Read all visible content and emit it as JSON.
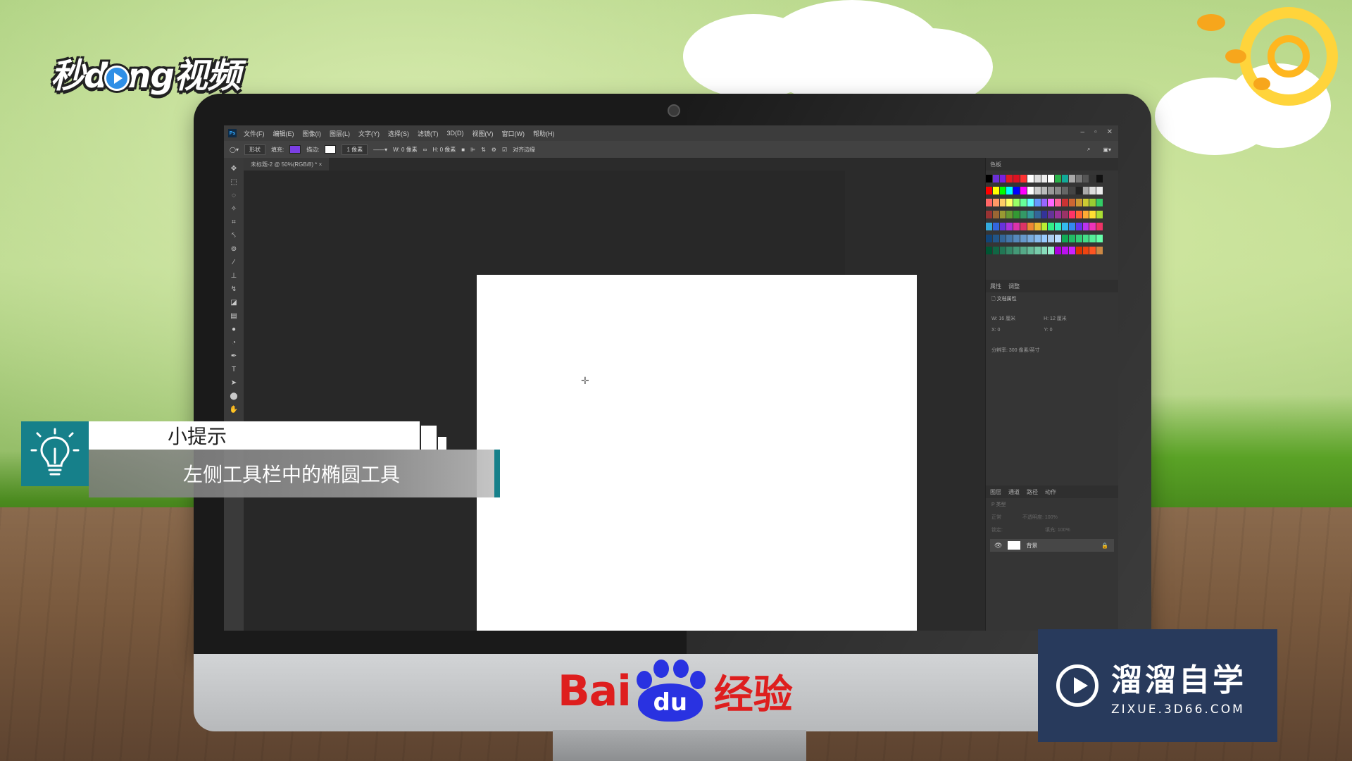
{
  "brand": {
    "logo_prefix": "秒d",
    "logo_suffix": "ng视频"
  },
  "menubar": {
    "items": [
      "文件(F)",
      "编辑(E)",
      "图像(I)",
      "图层(L)",
      "文字(Y)",
      "选择(S)",
      "滤镜(T)",
      "3D(D)",
      "视图(V)",
      "窗口(W)",
      "帮助(H)"
    ],
    "window_controls": [
      "–",
      "▫",
      "✕"
    ]
  },
  "options_bar": {
    "shape_mode": "形状",
    "fill_label": "填充:",
    "fill_color": "#7b3fe4",
    "stroke_label": "描边:",
    "stroke_width": "1 像素",
    "width_label": "W: 0 像素",
    "height_label": "H: 0 像素",
    "align_edges": "对齐边缘"
  },
  "document": {
    "tab_title": "未标题-2 @ 50%(RGB/8) * ×"
  },
  "swatches_panel": {
    "title": "色板"
  },
  "properties_panel": {
    "tabs": [
      "属性",
      "调整"
    ],
    "section": "文档属性",
    "width": "W: 16 厘米",
    "height": "H: 12 厘米",
    "x": "X: 0",
    "y": "Y: 0",
    "resolution": "分辨率: 300 像素/英寸"
  },
  "layers_panel": {
    "tabs": [
      "图层",
      "通道",
      "路径",
      "动作"
    ],
    "filter": "P 类型",
    "blend_mode": "正常",
    "opacity": "不透明度: 100%",
    "lock": "锁定:",
    "fill": "填充: 100%",
    "layer_name": "背景"
  },
  "tip": {
    "title": "小提示",
    "body": "左侧工具栏中的椭圆工具"
  },
  "baidu": {
    "part1": "Bai",
    "paw_text": "du",
    "part2": "经验"
  },
  "zixue": {
    "cn": "溜溜自学",
    "en": "ZIXUE.3D66.COM"
  },
  "colors": {
    "tip_teal": "#16808a",
    "zixue_bg": "#283a5c",
    "baidu_red": "#de1e1e",
    "baidu_blue": "#2932e1"
  }
}
